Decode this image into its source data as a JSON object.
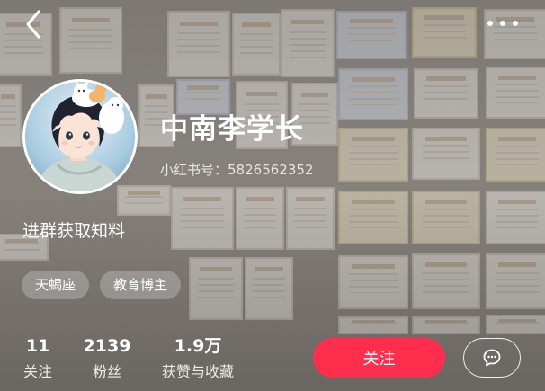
{
  "profile": {
    "nickname": "中南李学长",
    "id_label": "小红书号：",
    "id_value": "5826562352",
    "bio": "进群获取知料",
    "tags": [
      "天蝎座",
      "教育博主"
    ]
  },
  "stats": {
    "following": {
      "value": "11",
      "label": "关注"
    },
    "fans": {
      "value": "2139",
      "label": "粉丝"
    },
    "likes": {
      "value": "1.9万",
      "label": "获赞与收藏"
    }
  },
  "actions": {
    "follow_label": "关注"
  },
  "icons": {
    "back": "chevron-left-icon",
    "more": "more-dots-icon",
    "chat": "chat-bubble-icon"
  },
  "colors": {
    "follow_button": "#ff2e4d",
    "text": "#ffffff"
  }
}
